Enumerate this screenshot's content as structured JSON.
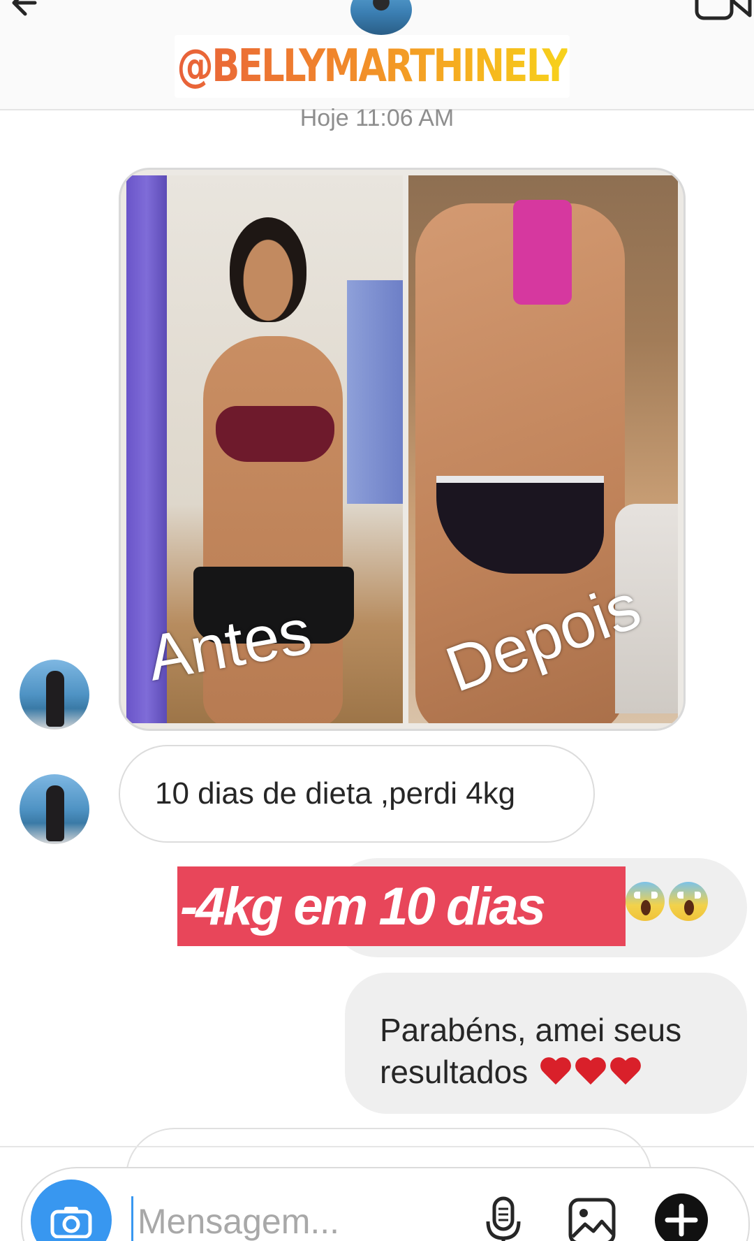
{
  "header": {
    "handle": "@BELLYMARTHINELY",
    "timestamp": "Hoje 11:06 AM"
  },
  "photo_message": {
    "left_caption": "Antes",
    "right_caption": "Depois"
  },
  "messages": [
    {
      "direction": "incoming",
      "text": "10 dias de dieta ,perdi 4kg"
    },
    {
      "direction": "outgoing",
      "text": "-4kg em 10 dias",
      "emoji": "scream-emoji"
    },
    {
      "direction": "outgoing",
      "text_line1": "Parabéns, amei seus",
      "text_line2": "resultados",
      "emoji": "heart-emoji"
    }
  ],
  "composer": {
    "placeholder": "Mensagem..."
  },
  "icons": {
    "back": "back-arrow-icon",
    "video": "video-call-icon",
    "camera": "camera-icon",
    "mic": "microphone-icon",
    "gallery": "gallery-icon",
    "plus": "plus-icon"
  },
  "colors": {
    "accent_blue": "#3897f0",
    "highlight_red": "#e8465a",
    "heart_red": "#d9202a",
    "bubble_grey": "#efefef"
  }
}
